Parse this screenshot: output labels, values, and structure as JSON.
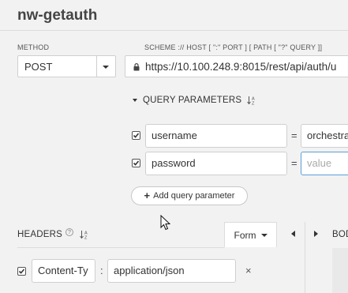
{
  "page": {
    "title": "nw-getauth"
  },
  "method": {
    "label": "METHOD",
    "value": "POST"
  },
  "url": {
    "label": "SCHEME :// HOST [ \":\" PORT ] [ PATH [ \"?\" QUERY ]]",
    "value": "https://10.100.248.9:8015/rest/api/auth/u"
  },
  "query": {
    "heading": "QUERY PARAMETERS",
    "params": [
      {
        "checked": true,
        "name": "username",
        "value": "orchestra",
        "placeholder": ""
      },
      {
        "checked": true,
        "name": "password",
        "value": "",
        "placeholder": "value"
      }
    ],
    "add_label": "Add query parameter"
  },
  "headers": {
    "heading": "HEADERS",
    "view_label": "Form",
    "rows": [
      {
        "checked": true,
        "name": "Content-Ty",
        "value": "application/json"
      }
    ]
  },
  "body": {
    "heading_partial": "BOD"
  },
  "colors": {
    "focus_border": "#5aa0d8",
    "background": "#f2f2f2"
  }
}
